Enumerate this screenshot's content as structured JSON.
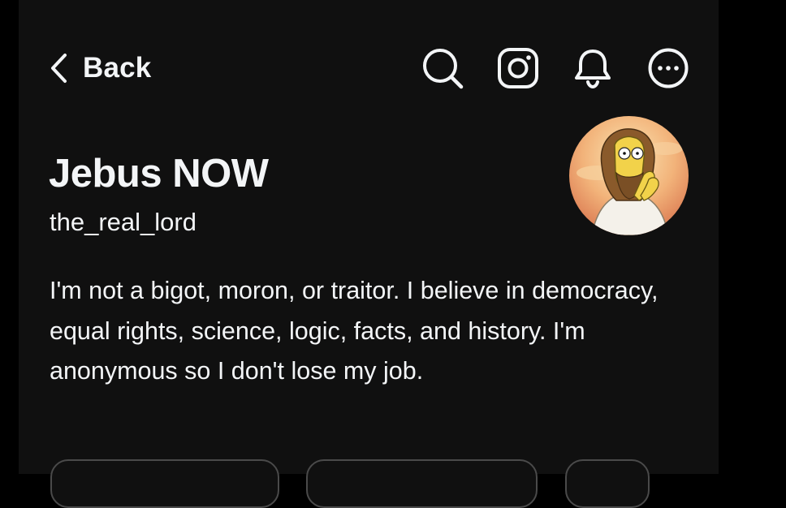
{
  "header": {
    "back_label": "Back",
    "icons": [
      "chevron-left-icon",
      "search-icon",
      "instagram-icon",
      "bell-icon",
      "more-icon"
    ]
  },
  "profile": {
    "display_name": "Jebus NOW",
    "username": "the_real_lord",
    "bio": "I'm not a bigot, moron, or traitor. I believe in democracy, equal rights, science, logic, facts, and history. I'm anonymous so I don't lose my job."
  },
  "colors": {
    "background": "#101010",
    "outer": "#000000",
    "text": "#f3f5f7",
    "pill_border": "#4a4a4a"
  }
}
